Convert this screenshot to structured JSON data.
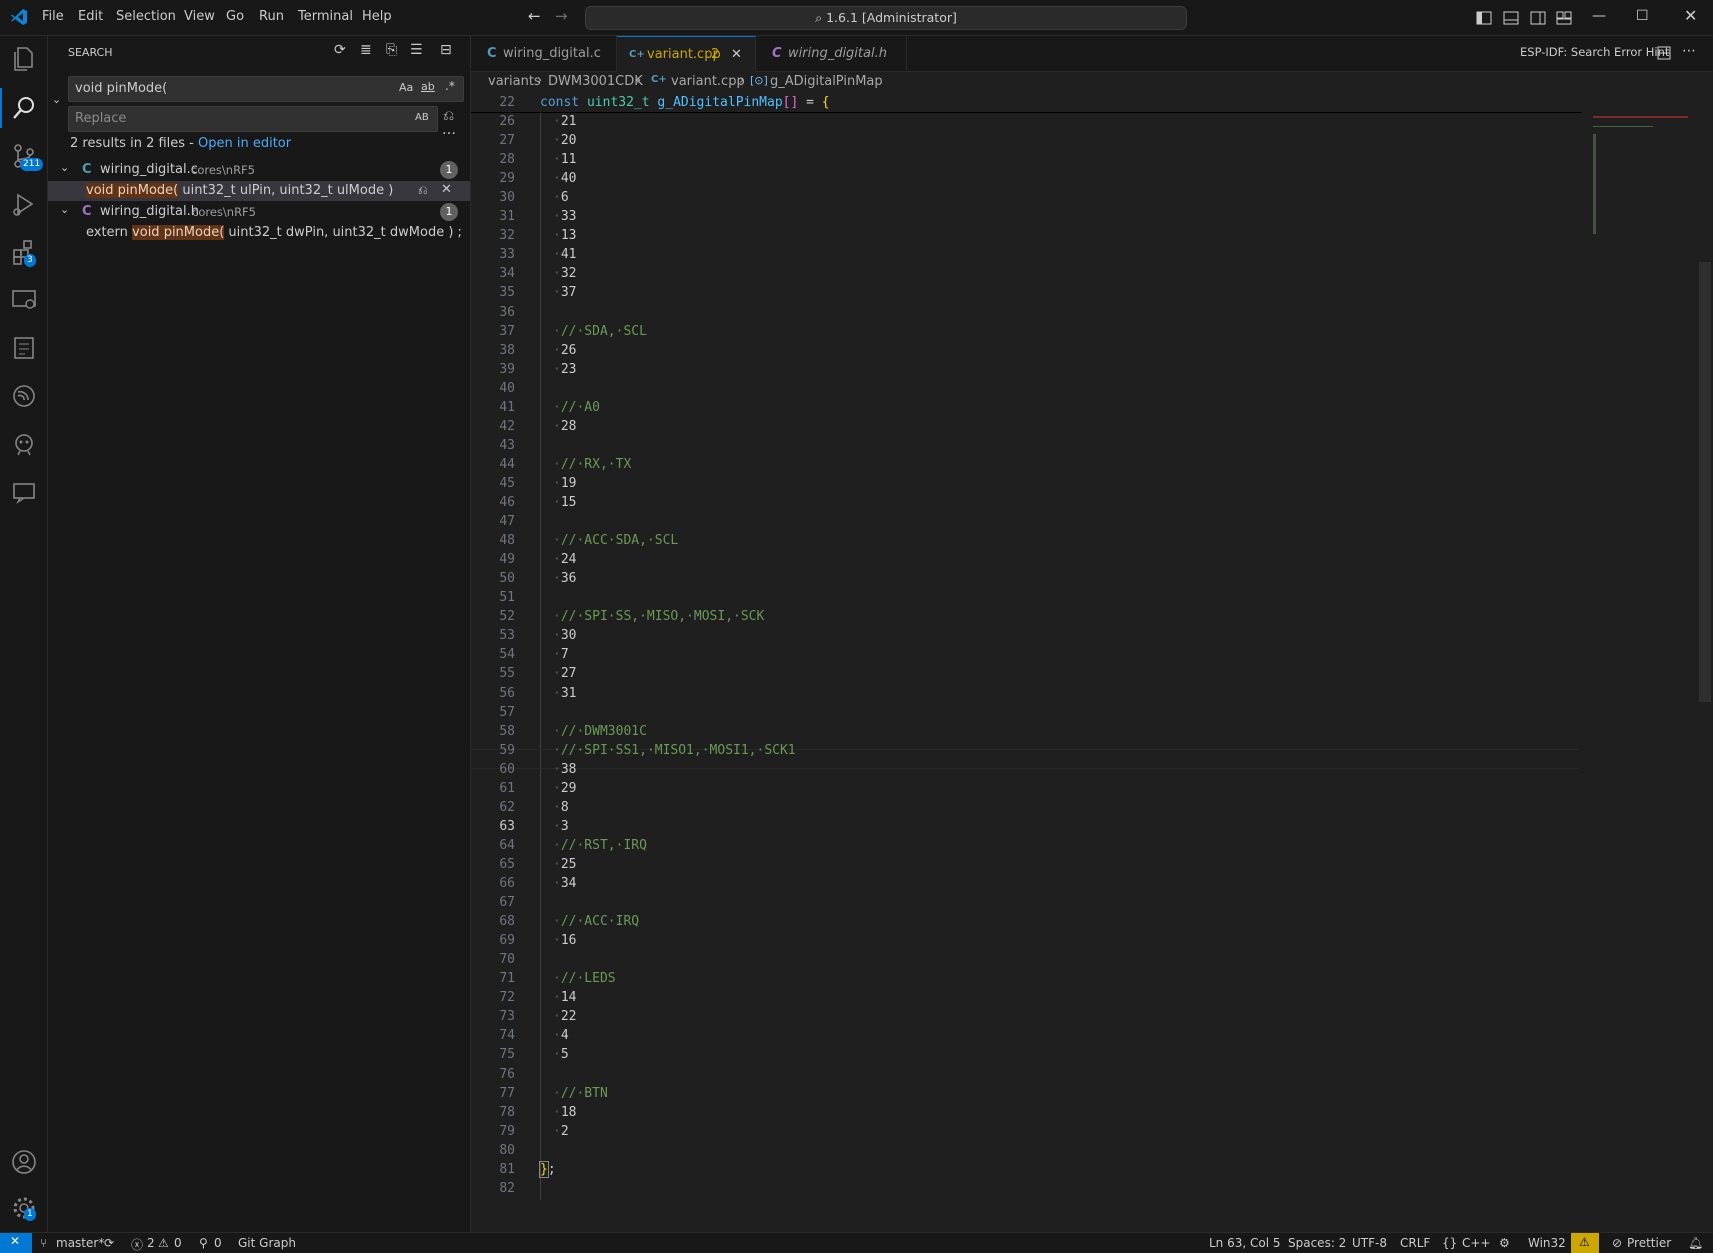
{
  "menu": [
    "File",
    "Edit",
    "Selection",
    "View",
    "Go",
    "Run",
    "Terminal",
    "Help"
  ],
  "command_center": "1.6.1 [Administrator]",
  "activity_badges": {
    "source_control": "211",
    "extensions": "3",
    "settings": "1"
  },
  "search": {
    "title": "SEARCH",
    "query": "void pinMode(",
    "replace_placeholder": "Replace",
    "case_label": "Aa",
    "word_label": "ab",
    "regex_label": ".*",
    "preserve_case_label": "AB",
    "results_summary": "2 results in 2 files - ",
    "open_in_editor": "Open in editor",
    "files": [
      {
        "icon": "C",
        "name": "wiring_digital.c",
        "path": "cores\\nRF5",
        "count": "1",
        "match_pre": "",
        "match": "void pinMode(",
        "match_post": " uint32_t ulPin, uint32_t ulMode )"
      },
      {
        "icon": "C",
        "name": "wiring_digital.h",
        "path": "cores\\nRF5",
        "count": "1",
        "match_pre": "extern ",
        "match": "void pinMode(",
        "match_post": " uint32_t dwPin, uint32_t dwMode ) ;"
      }
    ]
  },
  "tabs": [
    {
      "icon": "C",
      "label": "wiring_digital.c",
      "extra": ""
    },
    {
      "icon": "C+",
      "label": "variant.cpp",
      "extra": "2"
    },
    {
      "icon": "C",
      "label": "wiring_digital.h",
      "extra": ""
    }
  ],
  "editor_action": "ESP-IDF: Search Error Hint",
  "breadcrumb": [
    "variants",
    "DWM3001CDK",
    "variant.cpp",
    "g_ADigitalPinMap"
  ],
  "sticky": {
    "line": "22",
    "code": "const uint32_t g_ADigitalPinMap[] = {"
  },
  "lines": [
    [
      "26",
      "21,"
    ],
    [
      "27",
      "20,"
    ],
    [
      "28",
      "11,"
    ],
    [
      "29",
      "40,"
    ],
    [
      "30",
      "6,"
    ],
    [
      "31",
      "33,"
    ],
    [
      "32",
      "13,"
    ],
    [
      "33",
      "41,"
    ],
    [
      "34",
      "32,"
    ],
    [
      "35",
      "37,"
    ],
    [
      "36",
      ""
    ],
    [
      "37",
      "// SDA, SCL"
    ],
    [
      "38",
      "26,"
    ],
    [
      "39",
      "23,"
    ],
    [
      "40",
      ""
    ],
    [
      "41",
      "// A0"
    ],
    [
      "42",
      "28,"
    ],
    [
      "43",
      ""
    ],
    [
      "44",
      "// RX, TX"
    ],
    [
      "45",
      "19,"
    ],
    [
      "46",
      "15,"
    ],
    [
      "47",
      ""
    ],
    [
      "48",
      "// ACC SDA, SCL"
    ],
    [
      "49",
      "24,"
    ],
    [
      "50",
      "36,"
    ],
    [
      "51",
      ""
    ],
    [
      "52",
      "// SPI SS, MISO, MOSI, SCK"
    ],
    [
      "53",
      "30,"
    ],
    [
      "54",
      "7,"
    ],
    [
      "55",
      "27,"
    ],
    [
      "56",
      "31,"
    ],
    [
      "57",
      ""
    ],
    [
      "58",
      "// DWM3001C"
    ],
    [
      "59",
      "// SPI SS1, MISO1, MOSI1, SCK1"
    ],
    [
      "60",
      "38,"
    ],
    [
      "61",
      "29,"
    ],
    [
      "62",
      "8,"
    ],
    [
      "63",
      "3,"
    ],
    [
      "64",
      "// RST, IRQ"
    ],
    [
      "65",
      "25,"
    ],
    [
      "66",
      "34,"
    ],
    [
      "67",
      ""
    ],
    [
      "68",
      "// ACC IRQ"
    ],
    [
      "69",
      "16,"
    ],
    [
      "70",
      ""
    ],
    [
      "71",
      "// LEDS"
    ],
    [
      "72",
      "14,"
    ],
    [
      "73",
      "22,"
    ],
    [
      "74",
      "4,"
    ],
    [
      "75",
      "5,"
    ],
    [
      "76",
      ""
    ],
    [
      "77",
      "// BTN"
    ],
    [
      "78",
      "18,"
    ],
    [
      "79",
      "2"
    ],
    [
      "80",
      ""
    ],
    [
      "81",
      "};"
    ],
    [
      "82",
      ""
    ]
  ],
  "status": {
    "branch": "master*",
    "errors": "2",
    "warnings": "0",
    "ports": "0",
    "git_graph": "Git Graph",
    "position": "Ln 63, Col 5",
    "spaces": "Spaces: 2",
    "encoding": "UTF-8",
    "eol": "CRLF",
    "language": "C++",
    "platform": "Win32",
    "prettier": "Prettier"
  }
}
